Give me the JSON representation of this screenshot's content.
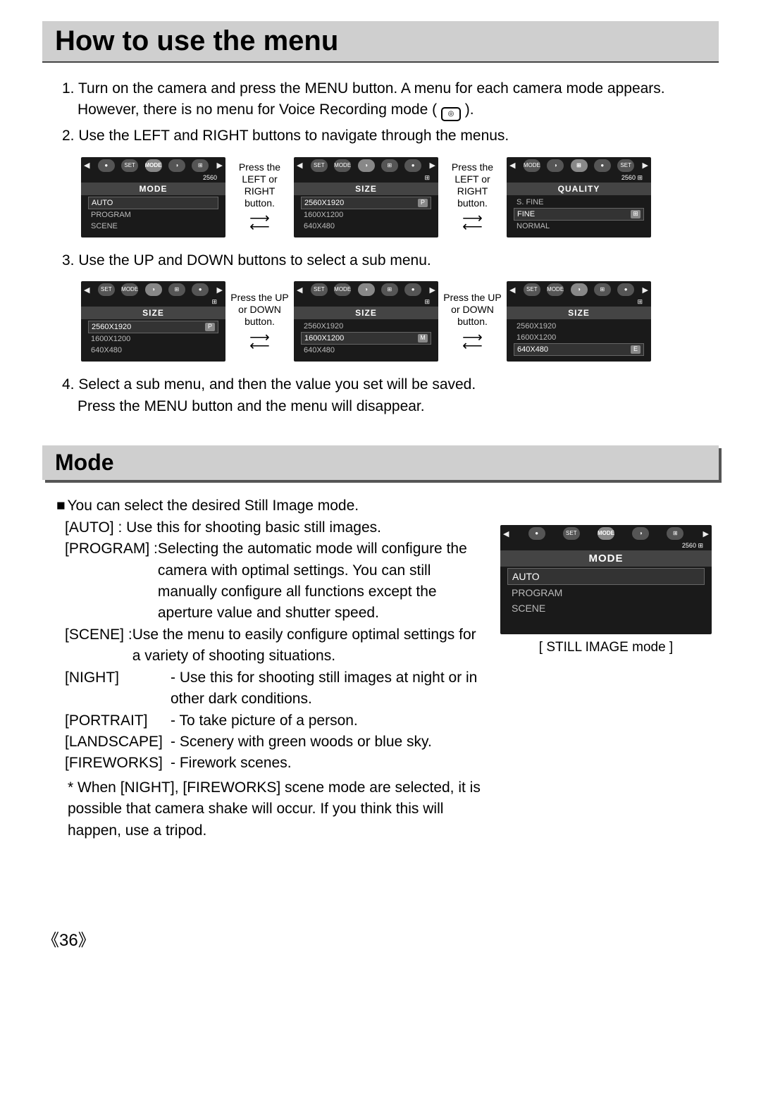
{
  "page_number": "《36》",
  "title": "How to use the menu",
  "steps": {
    "s1a": "1. Turn on the camera and press the MENU button. A menu for each camera mode appears.",
    "s1b": "However, there is no menu for Voice Recording mode (",
    "s1c": ").",
    "s2": "2. Use the LEFT and RIGHT buttons to navigate through the menus.",
    "s3": "3. Use the UP and DOWN buttons to select a sub menu.",
    "s4a": "4. Select a sub menu, and then the value you set will be saved.",
    "s4b": "Press the MENU button and the menu will disappear."
  },
  "between1": "Press the LEFT or RIGHT button.",
  "between2": "Press the UP or DOWN button.",
  "row1": {
    "screen1": {
      "title": "MODE",
      "activeTab": "MODE",
      "tabs": [
        "●",
        "SET",
        "MODE",
        "◑",
        "⊞"
      ],
      "sub": "2560",
      "items": [
        {
          "label": "AUTO",
          "hl": true,
          "mark": ""
        },
        {
          "label": "PROGRAM",
          "hl": false,
          "mark": ""
        },
        {
          "label": "SCENE",
          "hl": false,
          "mark": ""
        }
      ]
    },
    "screen2": {
      "title": "SIZE",
      "activeTab": "◑",
      "tabs": [
        "SET",
        "MODE",
        "◑",
        "⊞",
        "●"
      ],
      "sub": "⊞",
      "items": [
        {
          "label": "2560X1920",
          "hl": true,
          "mark": "P"
        },
        {
          "label": "1600X1200",
          "hl": false,
          "mark": ""
        },
        {
          "label": "640X480",
          "hl": false,
          "mark": ""
        }
      ]
    },
    "screen3": {
      "title": "QUALITY",
      "activeTab": "⊞",
      "tabs": [
        "MODE",
        "◑",
        "⊞",
        "●",
        "SET"
      ],
      "sub": "2560  ⊞",
      "items": [
        {
          "label": "S. FINE",
          "hl": false,
          "mark": ""
        },
        {
          "label": "FINE",
          "hl": true,
          "mark": "⊞"
        },
        {
          "label": "NORMAL",
          "hl": false,
          "mark": ""
        }
      ]
    }
  },
  "row2": {
    "screen1": {
      "title": "SIZE",
      "activeTab": "◑",
      "tabs": [
        "SET",
        "MODE",
        "◑",
        "⊞",
        "●"
      ],
      "sub": "⊞",
      "items": [
        {
          "label": "2560X1920",
          "hl": true,
          "mark": "P"
        },
        {
          "label": "1600X1200",
          "hl": false,
          "mark": ""
        },
        {
          "label": "640X480",
          "hl": false,
          "mark": ""
        }
      ]
    },
    "screen2": {
      "title": "SIZE",
      "activeTab": "◑",
      "tabs": [
        "SET",
        "MODE",
        "◑",
        "⊞",
        "●"
      ],
      "sub": "⊞",
      "items": [
        {
          "label": "2560X1920",
          "hl": false,
          "mark": ""
        },
        {
          "label": "1600X1200",
          "hl": true,
          "mark": "M"
        },
        {
          "label": "640X480",
          "hl": false,
          "mark": ""
        }
      ]
    },
    "screen3": {
      "title": "SIZE",
      "activeTab": "◑",
      "tabs": [
        "SET",
        "MODE",
        "◑",
        "⊞",
        "●"
      ],
      "sub": "⊞",
      "items": [
        {
          "label": "2560X1920",
          "hl": false,
          "mark": ""
        },
        {
          "label": "1600X1200",
          "hl": false,
          "mark": ""
        },
        {
          "label": "640X480",
          "hl": true,
          "mark": "E"
        }
      ]
    }
  },
  "section2": {
    "title": "Mode",
    "intro": "You can select the desired Still Image mode.",
    "defs": [
      {
        "k": "[AUTO]",
        "sep": " : ",
        "v": "Use this for shooting basic still images."
      },
      {
        "k": "[PROGRAM]",
        "sep": " : ",
        "v": "Selecting the automatic mode will configure the camera with optimal settings. You can still manually configure all functions except the aperture value and shutter speed."
      },
      {
        "k": "[SCENE]",
        "sep": " : ",
        "v": "Use the menu to easily configure optimal settings for a variety of shooting situations."
      },
      {
        "k": "[NIGHT]",
        "sep": "",
        "v": "- Use this for shooting still images at night or in other dark conditions."
      },
      {
        "k": "[PORTRAIT]",
        "sep": "",
        "v": "- To take picture of a person."
      },
      {
        "k": "[LANDSCAPE]",
        "sep": "",
        "v": "- Scenery with green woods or blue sky."
      },
      {
        "k": "[FIREWORKS]",
        "sep": "",
        "v": "- Firework scenes."
      }
    ],
    "footnote": "* When [NIGHT], [FIREWORKS] scene mode are selected, it is possible that camera shake will occur. If you think this will happen, use a tripod.",
    "screen": {
      "title": "MODE",
      "tabs": [
        "●",
        "SET",
        "MODE",
        "◑",
        "⊞"
      ],
      "sub": "2560  ⊞",
      "items": [
        {
          "label": "AUTO",
          "hl": true
        },
        {
          "label": "PROGRAM",
          "hl": false
        },
        {
          "label": "SCENE",
          "hl": false
        }
      ],
      "caption": "[ STILL IMAGE mode ]"
    }
  }
}
